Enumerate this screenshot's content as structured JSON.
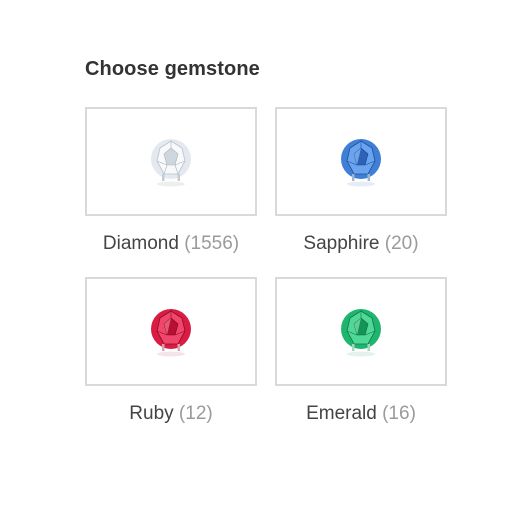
{
  "heading": "Choose gemstone",
  "gemstones": [
    {
      "name": "Diamond",
      "count": "(1556)",
      "icon": "diamond-gem-icon",
      "color": "#e6ebf0",
      "accent": "#aeb7c2"
    },
    {
      "name": "Sapphire",
      "count": "(20)",
      "icon": "sapphire-gem-icon",
      "color": "#4a86d8",
      "accent": "#1f4fa0"
    },
    {
      "name": "Ruby",
      "count": "(12)",
      "icon": "ruby-gem-icon",
      "color": "#e0204a",
      "accent": "#8e0a25"
    },
    {
      "name": "Emerald",
      "count": "(16)",
      "icon": "emerald-gem-icon",
      "color": "#27c079",
      "accent": "#0d7a45"
    }
  ]
}
